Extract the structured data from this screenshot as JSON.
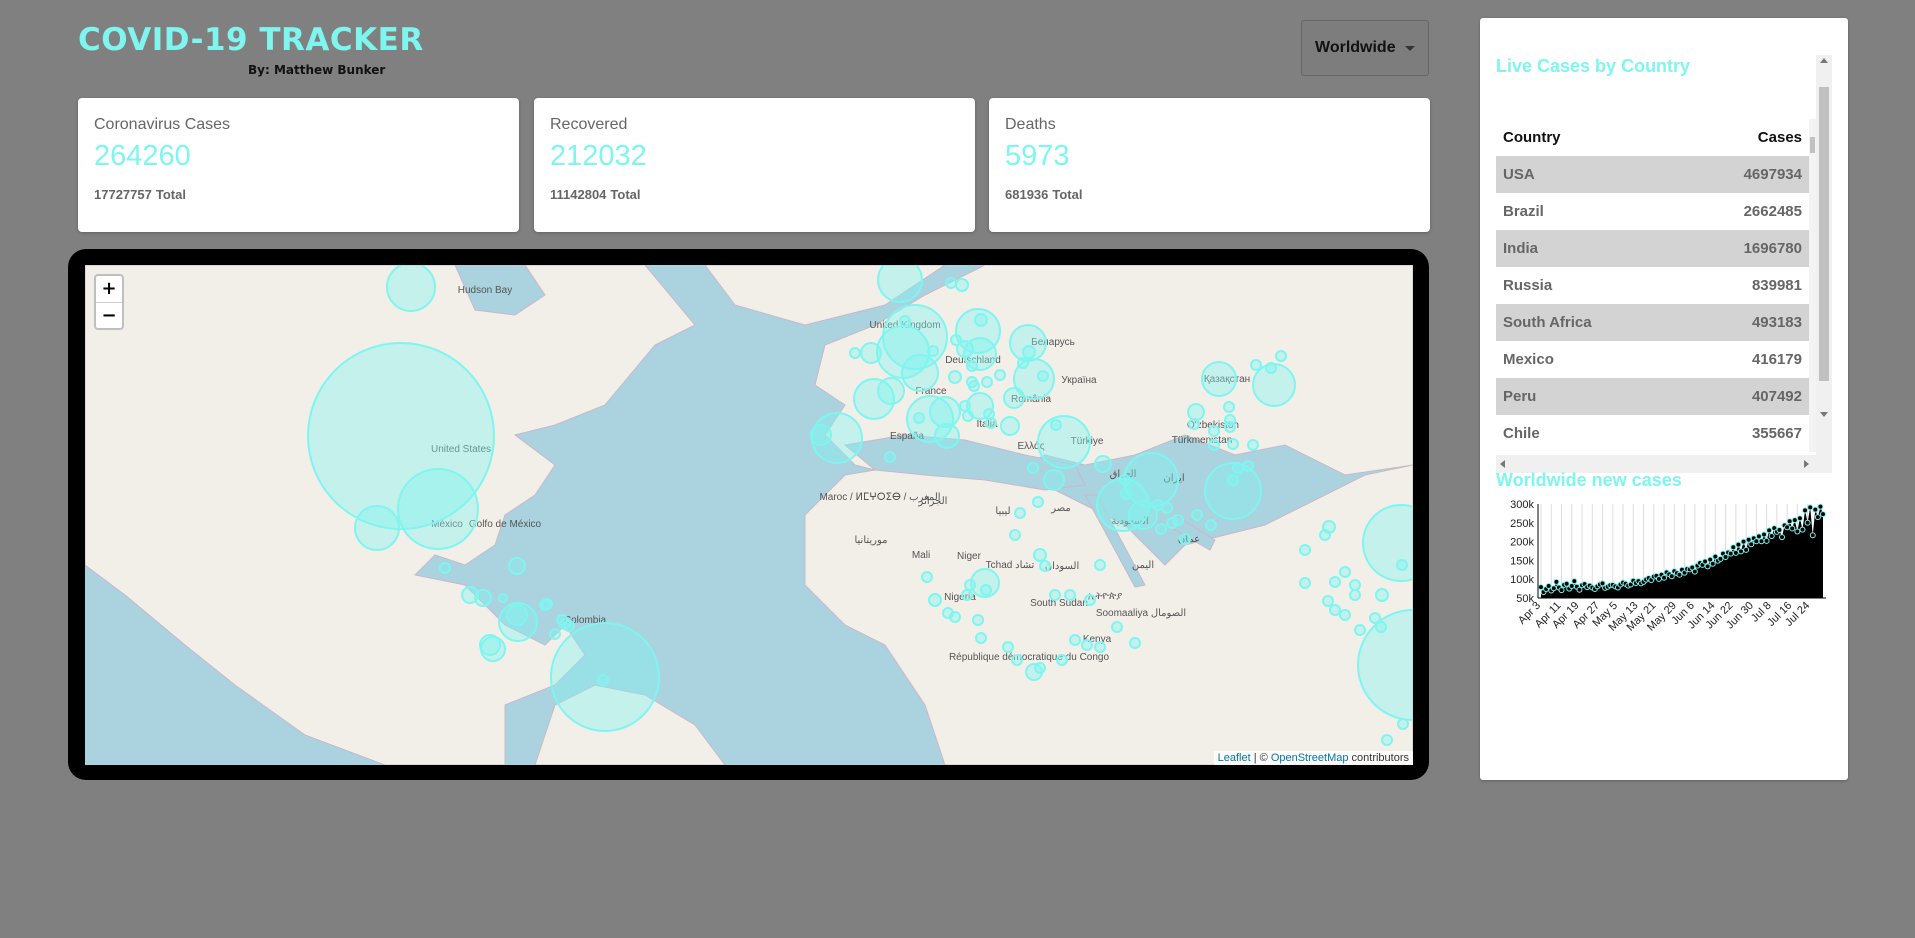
{
  "header": {
    "title": "COVID-19 TRACKER",
    "author": "By: Matthew Bunker"
  },
  "country_select": {
    "selected": "Worldwide"
  },
  "stats": [
    {
      "label": "Coronavirus Cases",
      "today": "264260",
      "total": "17727757",
      "total_suffix": "Total"
    },
    {
      "label": "Recovered",
      "today": "212032",
      "total": "11142804",
      "total_suffix": "Total"
    },
    {
      "label": "Deaths",
      "today": "5973",
      "total": "681936",
      "total_suffix": "Total"
    }
  ],
  "map": {
    "zoom_in": "+",
    "zoom_out": "−",
    "attribution": {
      "leaflet": "Leaflet",
      "sep": " | © ",
      "osm": "OpenStreetMap",
      "suffix": " contributors"
    },
    "labels": [
      "Hudson Bay",
      "United States",
      "México",
      "Golfo de México",
      "Colombia",
      "United Kingdom",
      "Deutschland",
      "France",
      "España",
      "Italia",
      "România",
      "Україна",
      "Беларусь",
      "Ελλάς",
      "Türkiye",
      "Maroc / ⵍⵎⵖⵔⵉⴱ / المغرب",
      "الجزائر",
      "ليبيا",
      "مصر",
      "موريتانيا",
      "Mali",
      "Niger",
      "Tchad تشاد",
      "السودان",
      "Nigeria",
      "South Sudan",
      "ኢትዮጵያ",
      "Soomaaliya الصومال",
      "Kenya",
      "République démocratique du Congo",
      "السعودية",
      "العراق",
      "ایران",
      "Türkmenistan",
      "O'zbekiston",
      "Қазақстан",
      "اليمن",
      "عمان"
    ],
    "accent": "#7ff5ef"
  },
  "table": {
    "title": "Live Cases by Country",
    "headers": {
      "country": "Country",
      "cases": "Cases"
    },
    "rows": [
      {
        "country": "USA",
        "cases": "4697934"
      },
      {
        "country": "Brazil",
        "cases": "2662485"
      },
      {
        "country": "India",
        "cases": "1696780"
      },
      {
        "country": "Russia",
        "cases": "839981"
      },
      {
        "country": "South Africa",
        "cases": "493183"
      },
      {
        "country": "Mexico",
        "cases": "416179"
      },
      {
        "country": "Peru",
        "cases": "407492"
      },
      {
        "country": "Chile",
        "cases": "355667"
      }
    ]
  },
  "chart_title": "Worldwide new cases",
  "chart_data": {
    "type": "area",
    "title": "Worldwide new cases",
    "xlabel": "",
    "ylabel": "",
    "ylim": [
      50000,
      300000
    ],
    "y_ticks": [
      "300k",
      "250k",
      "200k",
      "150k",
      "100k",
      "50k"
    ],
    "x_ticks": [
      "Apr 3",
      "Apr 11",
      "Apr 19",
      "Apr 27",
      "May 5",
      "May 13",
      "May 21",
      "May 29",
      "Jun 6",
      "Jun 14",
      "Jun 22",
      "Jun 30",
      "Jul 8",
      "Jul 16",
      "Jul 24"
    ],
    "series": [
      {
        "values": [
          79000,
          66000,
          74000,
          82000,
          70000,
          76000,
          93000,
          78000,
          71000,
          85000,
          88000,
          75000,
          82000,
          95000,
          80000,
          72000,
          84000,
          87000,
          79000,
          83000,
          78000,
          74000,
          81000,
          86000,
          89000,
          77000,
          80000,
          84000,
          85000,
          81000,
          78000,
          86000,
          91000,
          88000,
          83000,
          86000,
          96000,
          90000,
          95000,
          89000,
          93000,
          99000,
          103000,
          98000,
          107000,
          109000,
          101000,
          112000,
          104000,
          118000,
          113000,
          108000,
          121000,
          116000,
          112000,
          125000,
          117000,
          127000,
          126000,
          131000,
          120000,
          136000,
          143000,
          138000,
          147000,
          134000,
          152000,
          141000,
          160000,
          149000,
          154000,
          168000,
          159000,
          171000,
          168000,
          185000,
          170000,
          192000,
          174000,
          200000,
          178000,
          205000,
          193000,
          209000,
          201000,
          214000,
          201000,
          219000,
          202000,
          230000,
          215000,
          236000,
          226000,
          231000,
          212000,
          243000,
          238000,
          254000,
          235000,
          257000,
          227000,
          262000,
          232000,
          283000,
          250000,
          291000,
          217000,
          285000,
          265000,
          293000,
          273000
        ]
      }
    ],
    "grid": "vertical",
    "color": "#000000",
    "point_color": "#7ff5ef"
  }
}
